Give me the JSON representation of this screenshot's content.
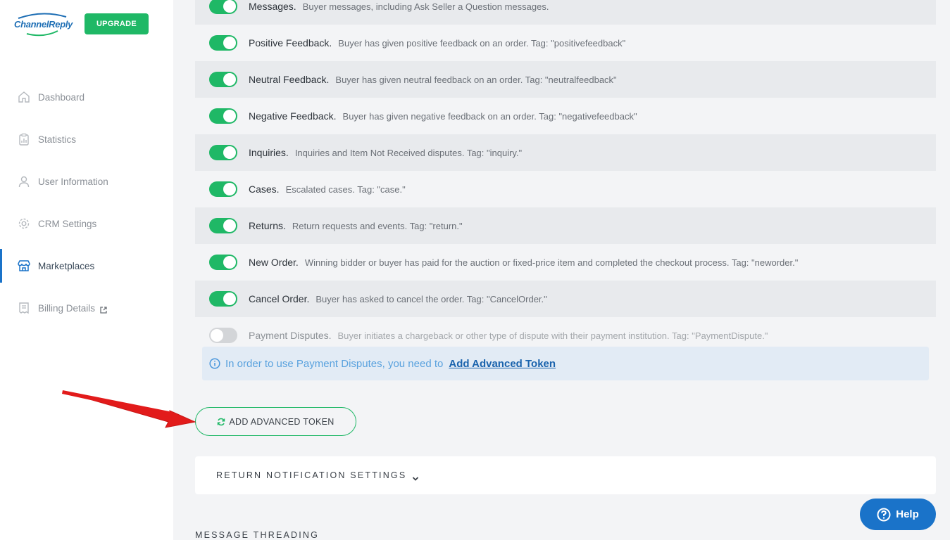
{
  "brand": {
    "logo_text": "ChannelReply",
    "upgrade_label": "UPGRADE"
  },
  "sidebar": {
    "items": [
      {
        "label": "Dashboard",
        "icon": "home-icon"
      },
      {
        "label": "Statistics",
        "icon": "clipboard-chart-icon"
      },
      {
        "label": "User Information",
        "icon": "user-icon"
      },
      {
        "label": "CRM Settings",
        "icon": "gear-icon"
      },
      {
        "label": "Marketplaces",
        "icon": "store-icon",
        "active": true
      },
      {
        "label": "Billing Details",
        "icon": "receipt-icon",
        "external": true
      }
    ]
  },
  "notifications": [
    {
      "title": "Messages.",
      "desc": "Buyer messages, including Ask Seller a Question messages.",
      "enabled": true
    },
    {
      "title": "Positive Feedback.",
      "desc": "Buyer has given positive feedback on an order. Tag: \"positivefeedback\"",
      "enabled": true
    },
    {
      "title": "Neutral Feedback.",
      "desc": "Buyer has given neutral feedback on an order. Tag: \"neutralfeedback\"",
      "enabled": true
    },
    {
      "title": "Negative Feedback.",
      "desc": "Buyer has given negative feedback on an order. Tag: \"negativefeedback\"",
      "enabled": true
    },
    {
      "title": "Inquiries.",
      "desc": "Inquiries and Item Not Received disputes. Tag: \"inquiry.\"",
      "enabled": true
    },
    {
      "title": "Cases.",
      "desc": "Escalated cases. Tag: \"case.\"",
      "enabled": true
    },
    {
      "title": "Returns.",
      "desc": "Return requests and events. Tag: \"return.\"",
      "enabled": true
    },
    {
      "title": "New Order.",
      "desc": "Winning bidder or buyer has paid for the auction or fixed-price item and completed the checkout process. Tag: \"neworder.\"",
      "enabled": true
    },
    {
      "title": "Cancel Order.",
      "desc": "Buyer has asked to cancel the order. Tag: \"CancelOrder.\"",
      "enabled": true
    },
    {
      "title": "Payment Disputes.",
      "desc": "Buyer initiates a chargeback or other type of dispute with their payment institution. Tag: \"PaymentDispute.\"",
      "enabled": false
    }
  ],
  "info": {
    "text": "In order to use Payment Disputes, you need to",
    "link": "Add Advanced Token"
  },
  "token_button": {
    "label": "ADD ADVANCED TOKEN",
    "icon": "refresh-icon"
  },
  "return_settings": {
    "label": "RETURN NOTIFICATION SETTINGS"
  },
  "message_threading": {
    "label": "MESSAGE THREADING"
  },
  "help": {
    "label": "Help"
  },
  "colors": {
    "accent_green": "#1fb866",
    "brand_blue": "#1a73c9",
    "arrow_red": "#e21b1b"
  }
}
